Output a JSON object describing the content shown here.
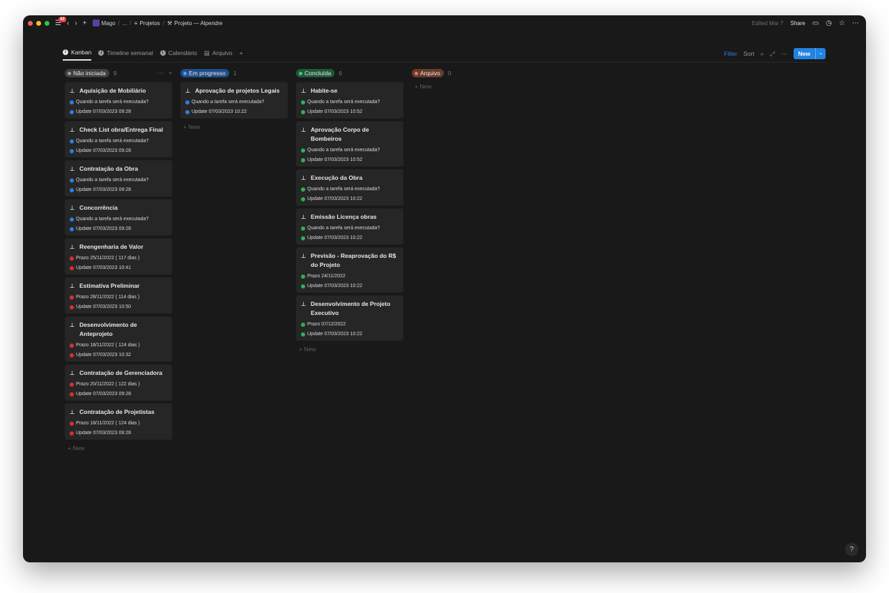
{
  "titlebar": {
    "badge": "43",
    "breadcrumbs": [
      "Mago",
      "...",
      "Projetos",
      "Projeto — Alpendre"
    ],
    "edited": "Edited Mar 7",
    "share": "Share"
  },
  "tabs": [
    {
      "label": "Kanban",
      "active": true
    },
    {
      "label": "Timeline semanal"
    },
    {
      "label": "Calendário"
    },
    {
      "label": "Arquivo"
    }
  ],
  "toolbar": {
    "filter": "Filter",
    "sort": "Sort",
    "new": "New"
  },
  "colors": {
    "accent": "#2383e2",
    "blue": "#2f7de1",
    "red": "#d83030",
    "green": "#30b050",
    "gray_pill": "#3f3f3f"
  },
  "columns": [
    {
      "label": "Não iniciada",
      "count": "9",
      "pill_bg": "#3f3f3f",
      "dot": "#9b9b9b",
      "cards": [
        {
          "title": "Aquisição de Mobiliário",
          "props": [
            {
              "color": "blue",
              "text": "Quando a tarefa será executada?"
            },
            {
              "color": "blue",
              "text": "Update 07/03/2023 09:28"
            }
          ]
        },
        {
          "title": "Check List obra/Entrega Final",
          "props": [
            {
              "color": "blue",
              "text": "Quando a tarefa será executada?"
            },
            {
              "color": "blue",
              "text": "Update 07/03/2023 09:28"
            }
          ]
        },
        {
          "title": "Contratação da Obra",
          "props": [
            {
              "color": "blue",
              "text": "Quando a tarefa será executada?"
            },
            {
              "color": "blue",
              "text": "Update 07/03/2023 09:28"
            }
          ]
        },
        {
          "title": "Concorrência",
          "props": [
            {
              "color": "blue",
              "text": "Quando a tarefa será executada?"
            },
            {
              "color": "blue",
              "text": "Update 07/03/2023 09:28"
            }
          ]
        },
        {
          "title": "Reengenharia de Valor",
          "props": [
            {
              "color": "red",
              "text": "Prazo 25/11/2022 ( 117 dias )"
            },
            {
              "color": "red",
              "text": "Update 07/03/2023 10:41"
            }
          ]
        },
        {
          "title": "Estimativa Preliminar",
          "props": [
            {
              "color": "red",
              "text": "Prazo 28/11/2022 ( 114 dias )"
            },
            {
              "color": "red",
              "text": "Update 07/03/2023 10:50"
            }
          ]
        },
        {
          "title": "Desenvolvimento de Anteprojeto",
          "props": [
            {
              "color": "red",
              "text": "Prazo 18/11/2022 ( 124 dias )"
            },
            {
              "color": "red",
              "text": "Update 07/03/2023 10:32"
            }
          ]
        },
        {
          "title": "Contratação de Gerenciadora",
          "props": [
            {
              "color": "red",
              "text": "Prazo 20/11/2022 ( 122 dias )"
            },
            {
              "color": "red",
              "text": "Update 07/03/2023 09:28"
            }
          ]
        },
        {
          "title": "Contratação de Projetistas",
          "props": [
            {
              "color": "red",
              "text": "Prazo 18/11/2022 ( 124 dias )"
            },
            {
              "color": "red",
              "text": "Update 07/03/2023 09:28"
            }
          ]
        }
      ],
      "add_new": "New"
    },
    {
      "label": "Em progresso",
      "count": "1",
      "pill_bg": "#1f4e8a",
      "dot": "#5a9cf0",
      "cards": [
        {
          "title": "Aprovação de projetos Legais",
          "props": [
            {
              "color": "blue",
              "text": "Quando a tarefa será executada?"
            },
            {
              "color": "blue",
              "text": "Update 07/03/2023 10:22"
            }
          ]
        }
      ],
      "add_new": "New"
    },
    {
      "label": "Concluída",
      "count": "6",
      "pill_bg": "#1f5a3a",
      "dot": "#4fc27a",
      "cards": [
        {
          "title": "Habite-se",
          "props": [
            {
              "color": "green",
              "text": "Quando a tarefa será executada?"
            },
            {
              "color": "green",
              "text": "Update 07/03/2023 10:52"
            }
          ]
        },
        {
          "title": "Aprovação Corpo de Bombeiros",
          "props": [
            {
              "color": "green",
              "text": "Quando a tarefa será executada?"
            },
            {
              "color": "green",
              "text": "Update 07/03/2023 10:52"
            }
          ]
        },
        {
          "title": "Execução da Obra",
          "props": [
            {
              "color": "green",
              "text": "Quando a tarefa será executada?"
            },
            {
              "color": "green",
              "text": "Update 07/03/2023 10:22"
            }
          ]
        },
        {
          "title": "Emissão Licença obras",
          "props": [
            {
              "color": "green",
              "text": "Quando a tarefa será executada?"
            },
            {
              "color": "green",
              "text": "Update 07/03/2023 10:22"
            }
          ]
        },
        {
          "title": "Previsão - Reaprovação do R$ do Projeto",
          "props": [
            {
              "color": "green",
              "text": "Prazo 24/11/2022"
            },
            {
              "color": "green",
              "text": "Update 07/03/2023 10:22"
            }
          ]
        },
        {
          "title": "Desenvolvimento de Projeto Executivo",
          "props": [
            {
              "color": "green",
              "text": "Prazo 07/12/2022"
            },
            {
              "color": "green",
              "text": "Update 07/03/2023 10:22"
            }
          ]
        }
      ],
      "add_new": "New"
    },
    {
      "label": "Arquivo",
      "count": "0",
      "pill_bg": "#6a3a2a",
      "dot": "#d98060",
      "cards": [],
      "add_new": "New"
    }
  ],
  "help": "?"
}
